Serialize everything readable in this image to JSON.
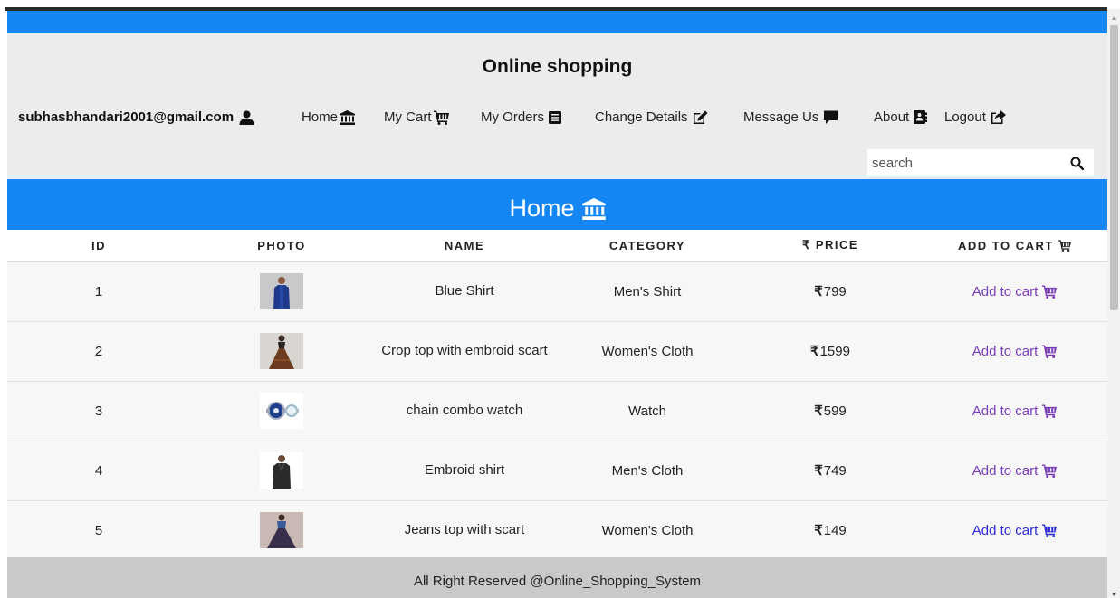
{
  "header": {
    "title": "Online shopping"
  },
  "nav": {
    "user_email": "subhasbhandari2001@gmail.com",
    "home": "Home",
    "my_cart": "My Cart",
    "my_orders": "My Orders",
    "change_details": "Change Details",
    "message_us": "Message Us",
    "about": "About",
    "logout": "Logout"
  },
  "search": {
    "placeholder": "search",
    "value": ""
  },
  "banner": {
    "title": "Home"
  },
  "table": {
    "headers": {
      "id": "ID",
      "photo": "PHOTO",
      "name": "NAME",
      "category": "CATEGORY",
      "price": "₹ PRICE",
      "add_to_cart": "ADD TO CART"
    },
    "rows": [
      {
        "id": "1",
        "name": "Blue Shirt",
        "category": "Men's Shirt",
        "price": "799",
        "action": "Add to cart",
        "photo": "blue-shirt-photo"
      },
      {
        "id": "2",
        "name": "Crop top with embroid scart",
        "category": "Women's Cloth",
        "price": "1599",
        "action": "Add to cart",
        "photo": "crop-top-photo"
      },
      {
        "id": "3",
        "name": "chain combo watch",
        "category": "Watch",
        "price": "599",
        "action": "Add to cart",
        "photo": "watch-photo"
      },
      {
        "id": "4",
        "name": "Embroid shirt",
        "category": "Men's Cloth",
        "price": "749",
        "action": "Add to cart",
        "photo": "embroid-shirt-photo"
      },
      {
        "id": "5",
        "name": "Jeans top with scart",
        "category": "Women's Cloth",
        "price": "149",
        "action": "Add to cart",
        "photo": "jeans-top-photo"
      }
    ],
    "currency_symbol": "₹"
  },
  "footer": {
    "text": "All Right Reserved @Online_Shopping_System"
  },
  "colors": {
    "primary_blue": "#1487f5",
    "header_bg": "#ececec",
    "footer_bg": "#c9c9c9",
    "link_purple": "#7a3db8",
    "link_blue": "#2a2ad9"
  }
}
